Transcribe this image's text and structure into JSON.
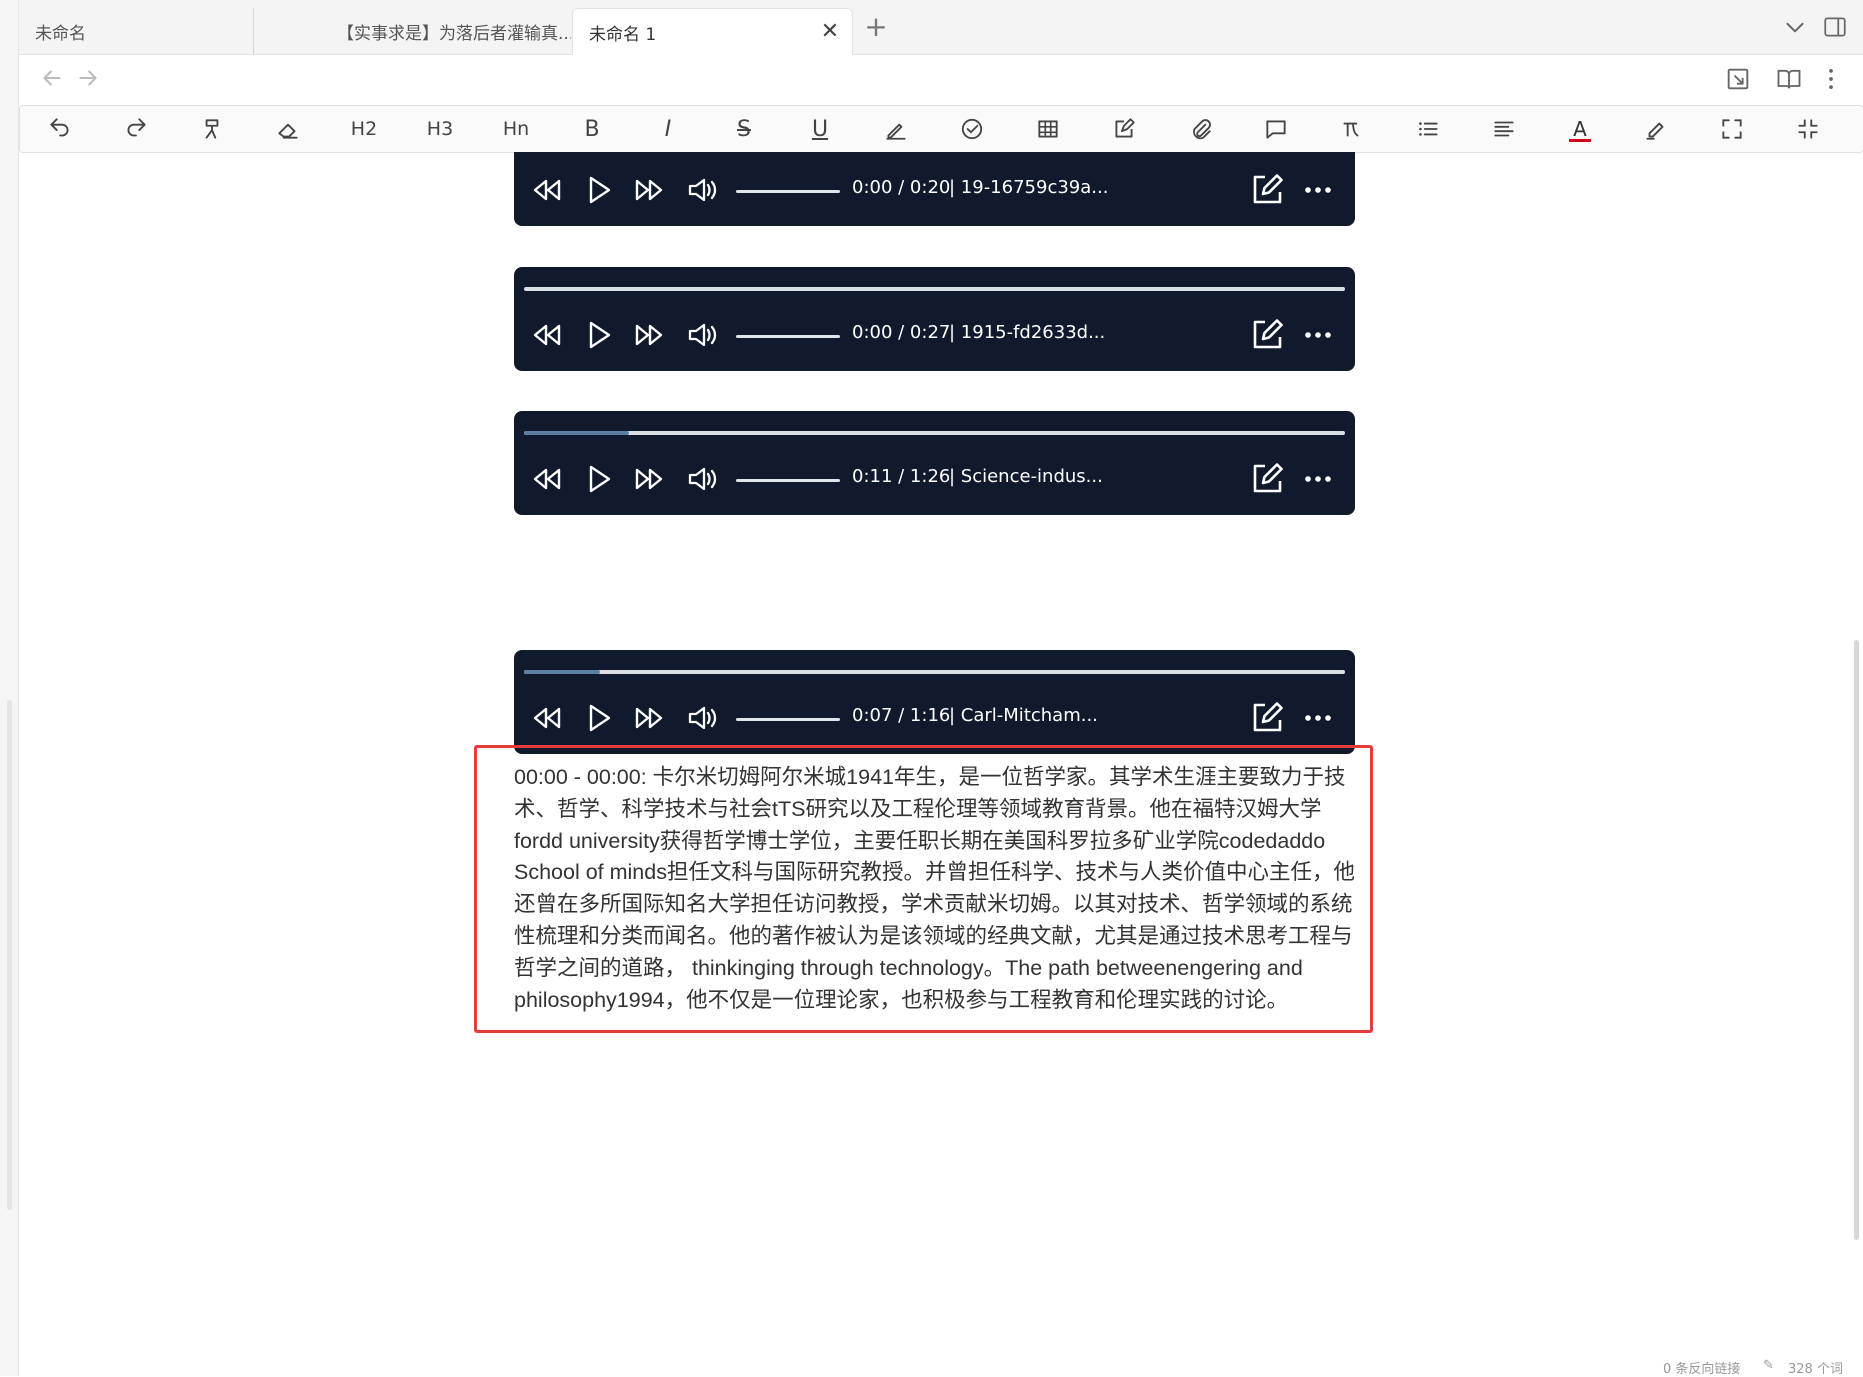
{
  "tabs": [
    {
      "label": "未命名"
    },
    {
      "label": "【实事求是】为落后者灌输真..."
    },
    {
      "label": "未命名 1",
      "close": "✕"
    }
  ],
  "tab_add": "+",
  "toolbar": {
    "h2": "H2",
    "h3": "H3",
    "hn": "Hn",
    "bold": "B",
    "italic": "I",
    "strike": "S",
    "underline": "U",
    "font_color": "A"
  },
  "players": [
    {
      "time": "0:00 / 0:20",
      "file": "| 19-16759c39a...",
      "progress": 0.0,
      "has_progress": false
    },
    {
      "time": "0:00 / 0:27",
      "file": "| 1915-fd2633d...",
      "progress": 0.0,
      "has_progress": true
    },
    {
      "time": "0:11 / 1:26",
      "file": "| Science-indus...",
      "progress": 0.128,
      "has_progress": true
    },
    {
      "time": "0:07 / 1:16",
      "file": "| Carl-Mitcham...",
      "progress": 0.092,
      "has_progress": true
    }
  ],
  "transcript": "00:00 - 00:00: 卡尔米切姆阿尔米城1941年生，是一位哲学家。其学术生涯主要致力于技术、哲学、科学技术与社会tTS研究以及工程伦理等领域教育背景。他在福特汉姆大学fordd university获得哲学博士学位，主要任职长期在美国科罗拉多矿业学院codedaddo School of minds担任文科与国际研究教授。并曾担任科学、技术与人类价值中心主任，他还曾在多所国际知名大学担任访问教授，学术贡献米切姆。以其对技术、哲学领域的系统性梳理和分类而闻名。他的著作被认为是该领域的经典文献，尤其是通过技术思考工程与哲学之间的道路， thinkinging through technology。The path betweenengering and philosophy1994，他不仅是一位理论家，也积极参与工程教育和伦理实践的讨论。",
  "status": {
    "backlinks": "0 条反向链接",
    "words": "328 个词"
  },
  "colors": {
    "player_bg": "#111a2c",
    "highlight": "#e63b3b",
    "font_color_underline": "#d0021b"
  }
}
